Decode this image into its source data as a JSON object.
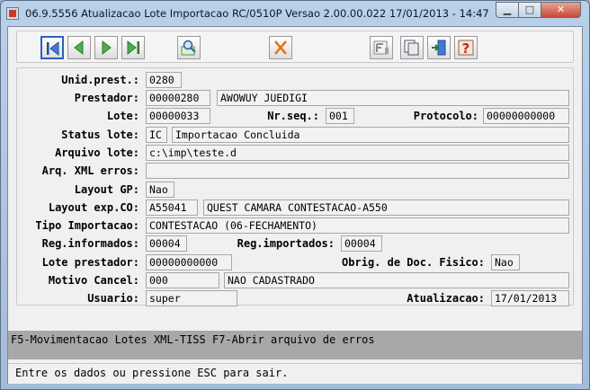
{
  "window": {
    "title": "06.9.5556 Atualizacao  Lote Importacao RC/0510P Versao 2.00.00.022 17/01/2013 - 14:47",
    "min_glyph": "▁",
    "max_glyph": "□",
    "close_glyph": "✕"
  },
  "toolbar": {
    "icons": [
      "first-record-icon",
      "prev-record-icon",
      "next-record-icon",
      "last-record-icon",
      "zoom-search-icon",
      "cancel-x-icon",
      "field-f-icon",
      "copy-icon",
      "exit-door-icon",
      "help-question-icon"
    ]
  },
  "form": {
    "unid_prest": {
      "label": "Unid.prest.:",
      "value": "0280"
    },
    "prestador": {
      "label": "Prestador:",
      "code": "00000280",
      "name": "AWOWUY JUEDIGI"
    },
    "lote": {
      "label": "Lote:",
      "value": "00000033"
    },
    "nr_seq": {
      "label": "Nr.seq.:",
      "value": "001"
    },
    "protocolo": {
      "label": "Protocolo:",
      "value": "00000000000"
    },
    "status_lote": {
      "label": "Status lote:",
      "code": "IC",
      "desc": "Importacao Concluida"
    },
    "arquivo_lote": {
      "label": "Arquivo lote:",
      "value": "c:\\imp\\teste.d"
    },
    "arq_xml_erros": {
      "label": "Arq. XML erros:",
      "value": ""
    },
    "layout_gp": {
      "label": "Layout GP:",
      "value": "Nao"
    },
    "layout_exp_co": {
      "label": "Layout exp.CO:",
      "code": "A55041",
      "desc": "QUEST CAMARA CONTESTACAO-A550"
    },
    "tipo_importacao": {
      "label": "Tipo Importacao:",
      "value": "CONTESTACAO (06-FECHAMENTO)"
    },
    "reg_informados": {
      "label": "Reg.informados:",
      "value": "00004"
    },
    "reg_importados": {
      "label": "Reg.importados:",
      "value": "00004"
    },
    "lote_prestador": {
      "label": "Lote prestador:",
      "value": "00000000000"
    },
    "obrig_doc_fisico": {
      "label": "Obrig. de Doc. Fisico:",
      "value": "Nao"
    },
    "motivo_cancel": {
      "label": "Motivo Cancel:",
      "code": "000",
      "desc": "NAO CADASTRADO"
    },
    "usuario": {
      "label": "Usuario:",
      "value": "super"
    },
    "atualizacao": {
      "label": "Atualizacao:",
      "value": "17/01/2013"
    }
  },
  "hint": "F5-Movimentacao Lotes XML-TISS F7-Abrir arquivo de erros",
  "status": "Entre os dados ou pressione ESC para sair.",
  "colors": {
    "title_bar": "#b9d0ea",
    "client_bg": "#f0f0f0",
    "hint_bar": "#a8a8a8",
    "close_button": "#c74a35"
  }
}
